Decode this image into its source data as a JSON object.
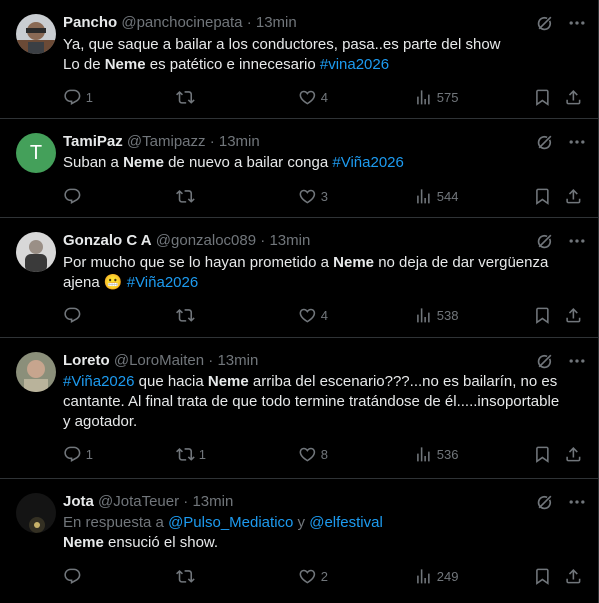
{
  "tweets": [
    {
      "name": "Pancho",
      "handle": "@panchocinepata",
      "dot": "·",
      "time": "13min",
      "lines": [
        [
          {
            "t": "Ya, que saque a bailar a los conductores, pasa..es parte del show",
            "s": ""
          }
        ],
        [
          {
            "t": "Lo de ",
            "s": ""
          },
          {
            "t": "Neme",
            "s": "bold"
          },
          {
            "t": " es patético e innecesario ",
            "s": ""
          },
          {
            "t": "#vina2026",
            "s": "link"
          }
        ]
      ],
      "reply_count": "1",
      "retweet_count": "",
      "like_count": "4",
      "views": "575"
    },
    {
      "name": "TamiPaz",
      "handle": "@Tamipazz",
      "dot": "·",
      "time": "13min",
      "avatar_letter": "T",
      "lines": [
        [
          {
            "t": "Suban a ",
            "s": ""
          },
          {
            "t": "Neme",
            "s": "bold"
          },
          {
            "t": " de nuevo a bailar conga  ",
            "s": ""
          },
          {
            "t": "#Viña2026",
            "s": "link"
          }
        ]
      ],
      "reply_count": "",
      "retweet_count": "",
      "like_count": "3",
      "views": "544"
    },
    {
      "name": "Gonzalo C A",
      "handle": "@gonzaloc089",
      "dot": "·",
      "time": "13min",
      "lines": [
        [
          {
            "t": "Por mucho que se lo hayan prometido a  ",
            "s": ""
          },
          {
            "t": "Neme",
            "s": "bold"
          },
          {
            "t": " no deja de dar vergüenza",
            "s": ""
          }
        ],
        [
          {
            "t": "ajena ",
            "s": ""
          },
          {
            "t": "😬",
            "s": "emoji"
          },
          {
            "t": " ",
            "s": ""
          },
          {
            "t": "#Viña2026",
            "s": "link"
          }
        ]
      ],
      "reply_count": "",
      "retweet_count": "",
      "like_count": "4",
      "views": "538"
    },
    {
      "name": "Loreto",
      "handle": "@LoroMaiten",
      "dot": "·",
      "time": "13min",
      "lines": [
        [
          {
            "t": "#Viña2026",
            "s": "link"
          },
          {
            "t": " que hacia ",
            "s": ""
          },
          {
            "t": "Neme",
            "s": "bold"
          },
          {
            "t": " arriba del escenario???...no es bailarín, no es",
            "s": ""
          }
        ],
        [
          {
            "t": "cantante. Al final trata de que todo termine tratándose de él.....insoportable",
            "s": ""
          }
        ],
        [
          {
            "t": "y agotador.",
            "s": ""
          }
        ]
      ],
      "reply_count": "1",
      "retweet_count": "1",
      "like_count": "8",
      "views": "536"
    },
    {
      "name": "Jota",
      "handle": "@JotaTeuer",
      "dot": "·",
      "time": "13min",
      "lines": [
        [
          {
            "t": "En respuesta a ",
            "s": "muted"
          },
          {
            "t": "@Pulso_Mediatico",
            "s": "link"
          },
          {
            "t": " y ",
            "s": "muted"
          },
          {
            "t": "@elfestival",
            "s": "link"
          }
        ],
        [
          {
            "t": "Neme",
            "s": "bold"
          },
          {
            "t": " ensució el show.",
            "s": ""
          }
        ]
      ],
      "reply_count": "",
      "retweet_count": "",
      "like_count": "2",
      "views": "249"
    }
  ]
}
